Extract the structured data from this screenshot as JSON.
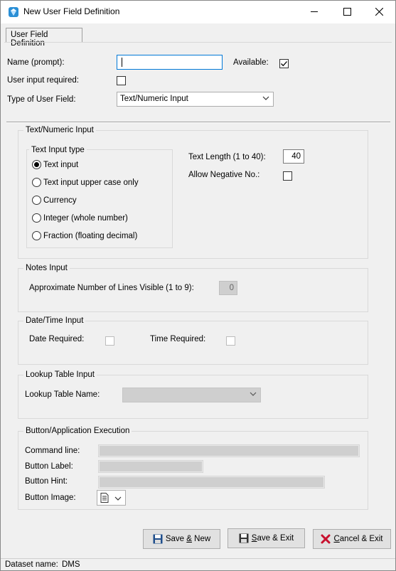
{
  "window": {
    "title": "New User Field Definition",
    "min_icon": "minimize-icon",
    "max_icon": "maximize-icon",
    "close_icon": "close-icon"
  },
  "tabs": [
    "User Field Definition"
  ],
  "form": {
    "name_label": "Name (prompt):",
    "name_value": "",
    "available_label": "Available:",
    "available_checked": true,
    "required_label": "User input required:",
    "required_checked": false,
    "type_label": "Type of User Field:",
    "type_value": "Text/Numeric Input"
  },
  "text_numeric": {
    "title": "Text/Numeric Input",
    "input_type_title": "Text Input type",
    "options": [
      "Text input",
      "Text input upper case only",
      "Currency",
      "Integer (whole number)",
      "Fraction (floating decimal)"
    ],
    "selected_index": 0,
    "length_label": "Text Length (1 to 40):",
    "length_value": "40",
    "negative_label": "Allow Negative No.:",
    "negative_checked": false
  },
  "notes": {
    "title": "Notes Input",
    "lines_label": "Approximate Number of Lines Visible (1 to 9):",
    "lines_value": "0"
  },
  "datetime": {
    "title": "Date/Time Input",
    "date_label": "Date Required:",
    "time_label": "Time Required:"
  },
  "lookup": {
    "title": "Lookup Table Input",
    "name_label": "Lookup Table Name:",
    "name_value": ""
  },
  "button_exec": {
    "title": "Button/Application Execution",
    "command_label": "Command line:",
    "command_value": "",
    "label_label": "Button Label:",
    "label_value": "",
    "hint_label": "Button Hint:",
    "hint_value": "",
    "image_label": "Button Image:"
  },
  "buttons": {
    "save_new_pre": "Save ",
    "save_new_key": "&",
    "save_new_post": " New",
    "save_exit_pre": "",
    "save_exit_key": "S",
    "save_exit_post": "ave & Exit",
    "cancel_pre": "",
    "cancel_key": "C",
    "cancel_post": "ancel & Exit"
  },
  "status": {
    "dataset_label": "Dataset name:",
    "dataset_value": "DMS"
  },
  "colors": {
    "accent": "#0078d7",
    "cancel_red": "#c8102e",
    "disk_blue": "#1f4e8c"
  }
}
